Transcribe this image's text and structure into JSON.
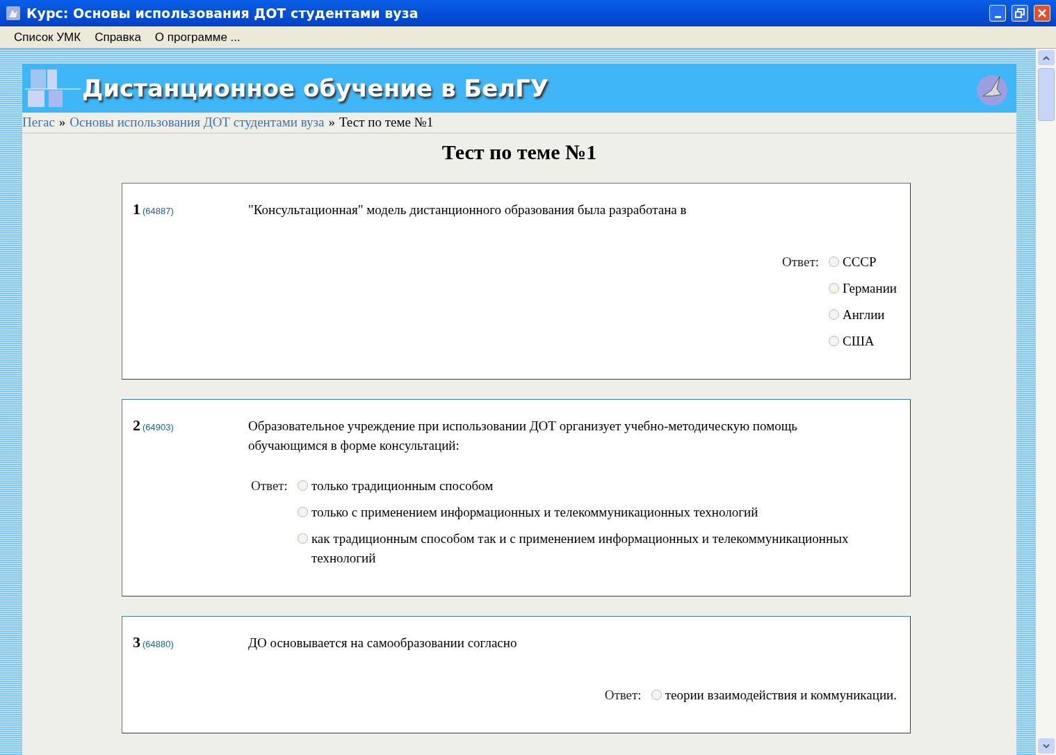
{
  "window": {
    "title": "Курс: Основы использования ДОТ студентами вуза"
  },
  "menu": [
    "Список УМК",
    "Справка",
    "О программе ..."
  ],
  "banner": {
    "title": "Дистанционное обучение в БелГУ"
  },
  "breadcrumb": {
    "links": [
      "Пегас",
      "Основы использования ДОТ студентами вуза"
    ],
    "separator": "»",
    "current": "Тест по теме №1"
  },
  "heading": "Тест по теме №1",
  "questions": [
    {
      "number": "1",
      "id": "(64887)",
      "text": "\"Консультационная\" модель дистанционного образования была разработана в",
      "answer_label": "Ответ:",
      "kind": "right",
      "options": [
        {
          "label": "СССР",
          "selected": false
        },
        {
          "label": "Германии",
          "selected": false
        },
        {
          "label": "Англии",
          "selected": false
        },
        {
          "label": "США",
          "selected": false
        }
      ]
    },
    {
      "number": "2",
      "id": "(64903)",
      "text": "Образовательное учреждение при использовании ДОТ организует учебно-методическую помощь обучающимся в форме консультаций:",
      "answer_label": "Ответ:",
      "kind": "left",
      "options": [
        {
          "label": "только традиционным способом",
          "selected": false
        },
        {
          "label": "только с применением информационных и телекоммуникационных технологий",
          "selected": false
        },
        {
          "label": "как традиционным способом так и с применением информационных и телекоммуникационных технологий",
          "selected": false
        }
      ]
    },
    {
      "number": "3",
      "id": "(64880)",
      "text": "ДО основывается на самообразовании согласно",
      "answer_label": "Ответ:",
      "kind": "right",
      "options": [
        {
          "label": "теории взаимодействия и коммуникации.",
          "selected": false
        }
      ]
    }
  ]
}
